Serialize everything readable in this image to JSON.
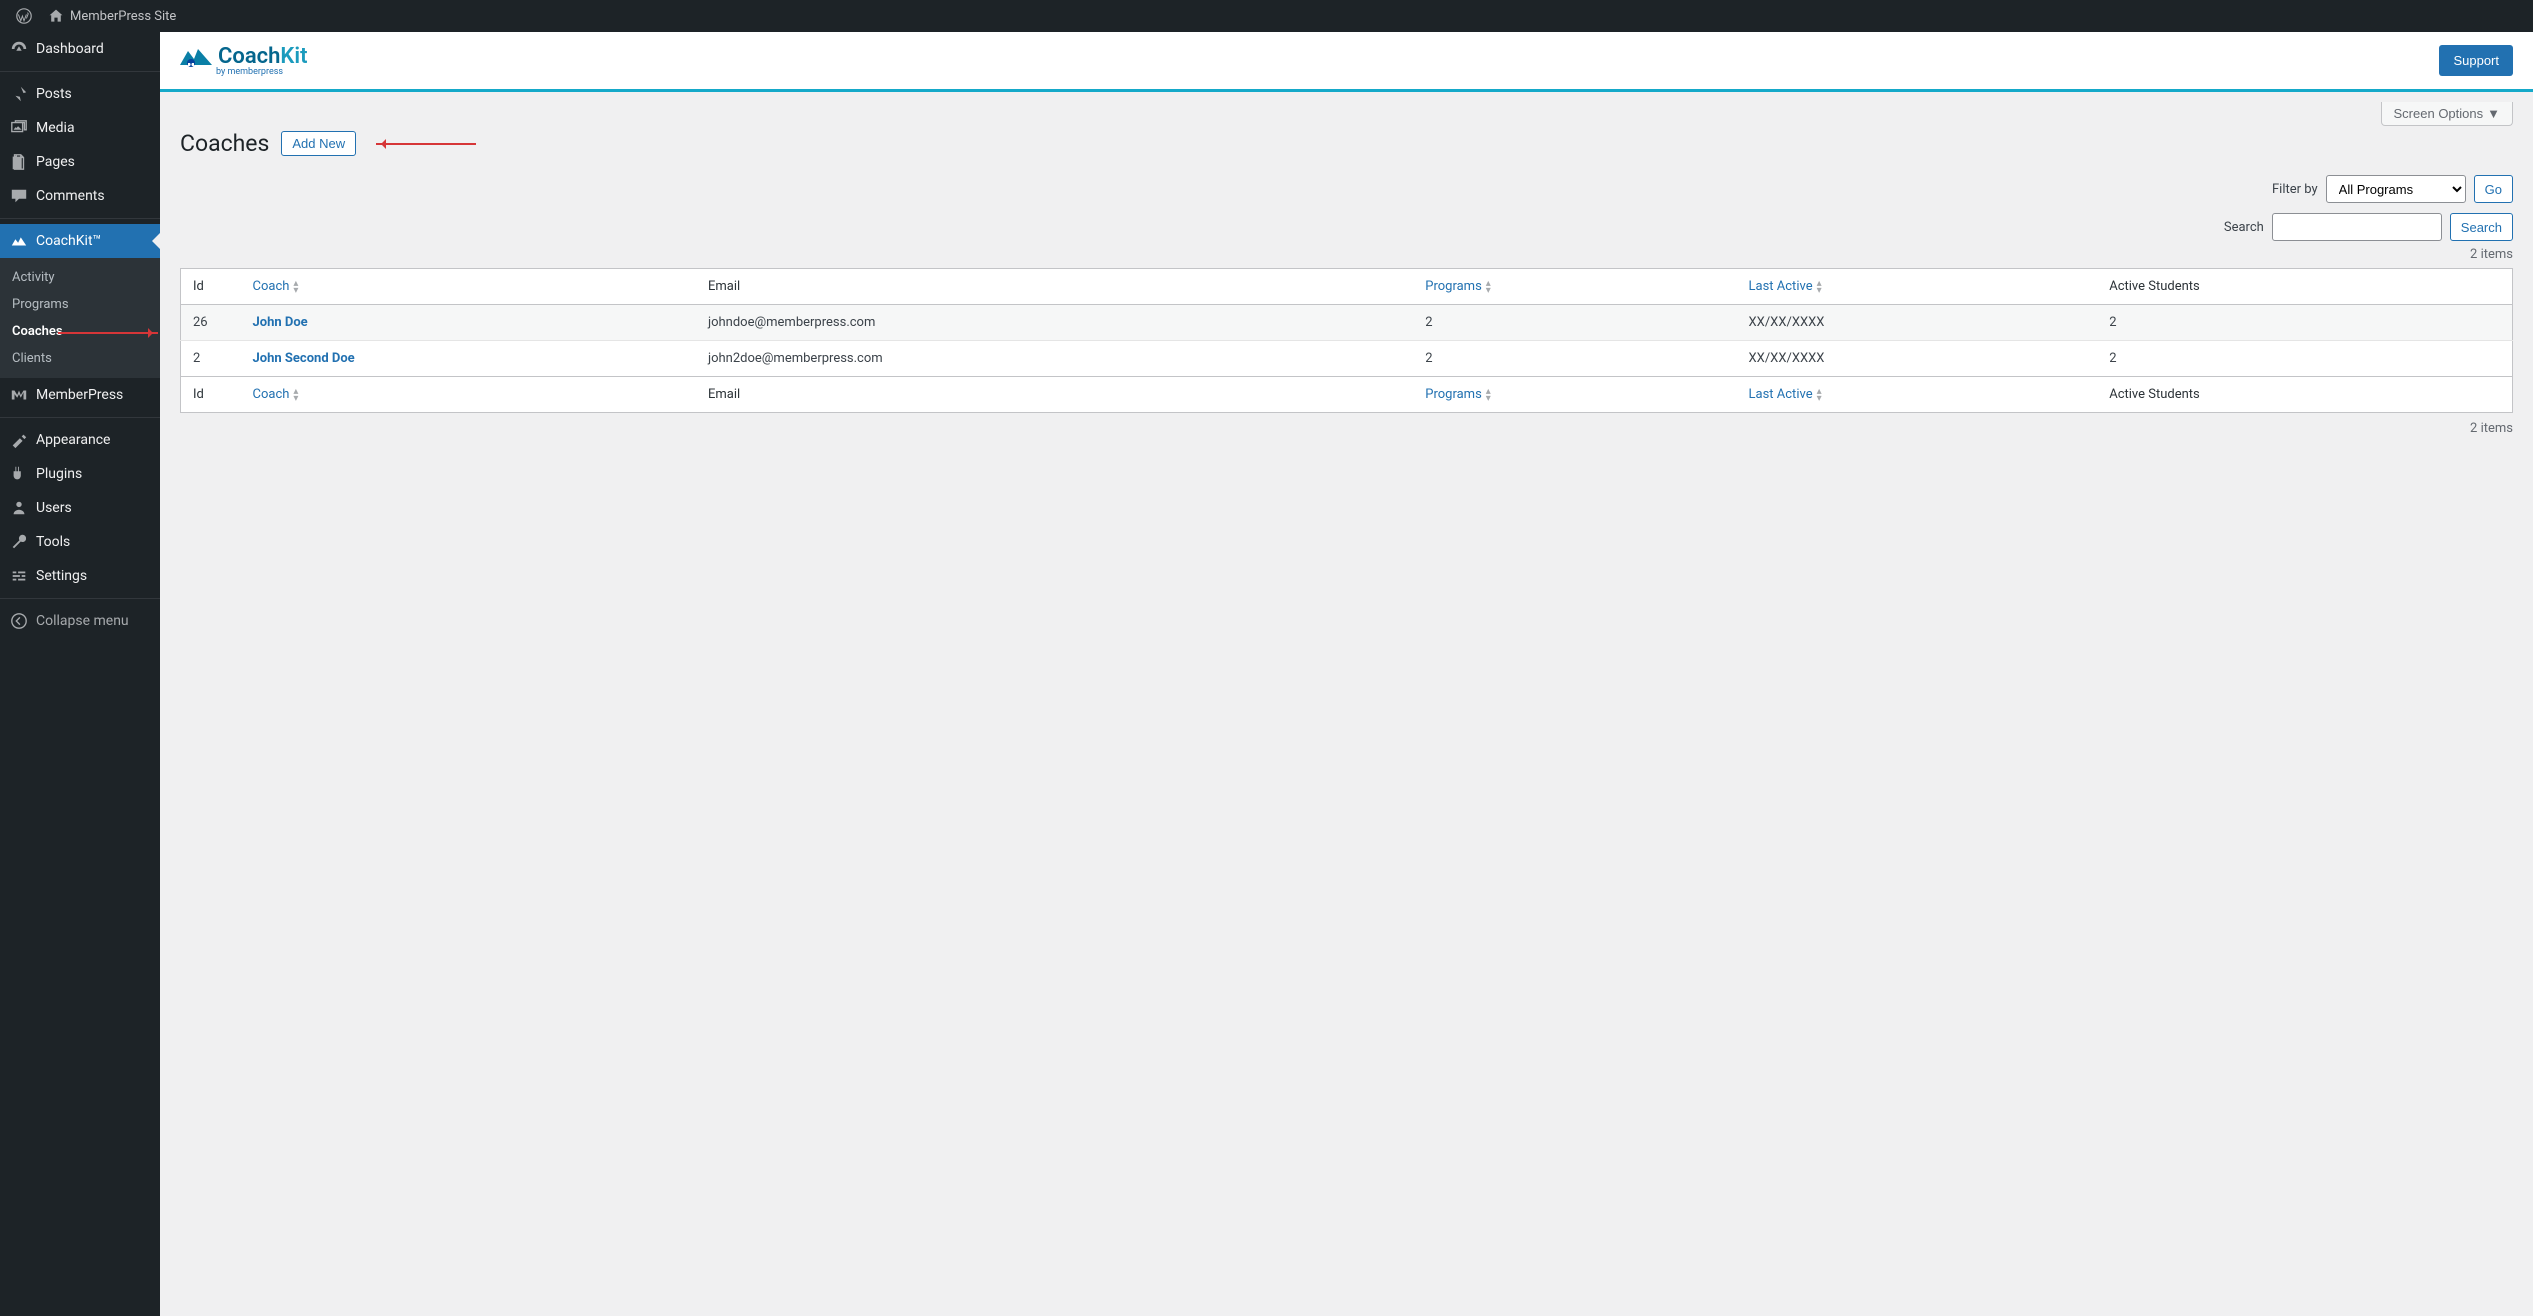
{
  "adminbar": {
    "site_name": "MemberPress Site"
  },
  "sidebar": {
    "items": [
      {
        "icon": "dashboard",
        "label": "Dashboard"
      },
      {
        "icon": "pin",
        "label": "Posts"
      },
      {
        "icon": "media",
        "label": "Media"
      },
      {
        "icon": "pages",
        "label": "Pages"
      },
      {
        "icon": "comments",
        "label": "Comments"
      },
      {
        "icon": "coachkit",
        "label": "CoachKit™",
        "active": true
      },
      {
        "icon": "mp",
        "label": "MemberPress"
      },
      {
        "icon": "appearance",
        "label": "Appearance"
      },
      {
        "icon": "plugins",
        "label": "Plugins"
      },
      {
        "icon": "users",
        "label": "Users"
      },
      {
        "icon": "tools",
        "label": "Tools"
      },
      {
        "icon": "settings",
        "label": "Settings"
      },
      {
        "icon": "collapse",
        "label": "Collapse menu"
      }
    ],
    "submenu": {
      "items": [
        {
          "label": "Activity"
        },
        {
          "label": "Programs"
        },
        {
          "label": "Coaches",
          "current": true
        },
        {
          "label": "Clients"
        }
      ]
    }
  },
  "brand": {
    "coach": "Coach",
    "kit": "Kit",
    "sub": "by memberpress",
    "support": "Support"
  },
  "screen_options": "Screen Options",
  "page": {
    "title": "Coaches",
    "add_new": "Add New"
  },
  "filters": {
    "filter_by_label": "Filter by",
    "all_programs": "All Programs",
    "go": "Go",
    "search_label": "Search",
    "search_btn": "Search",
    "items_count": "2 items"
  },
  "table": {
    "headers": {
      "id": "Id",
      "coach": "Coach",
      "email": "Email",
      "programs": "Programs",
      "last_active": "Last Active",
      "active_students": "Active Students"
    },
    "rows": [
      {
        "id": "26",
        "coach": "John Doe",
        "email": "johndoe@memberpress.com",
        "programs": "2",
        "last_active": "XX/XX/XXXX",
        "active_students": "2"
      },
      {
        "id": "2",
        "coach": "John Second Doe",
        "email": "john2doe@memberpress.com",
        "programs": "2",
        "last_active": "XX/XX/XXXX",
        "active_students": "2"
      }
    ]
  }
}
